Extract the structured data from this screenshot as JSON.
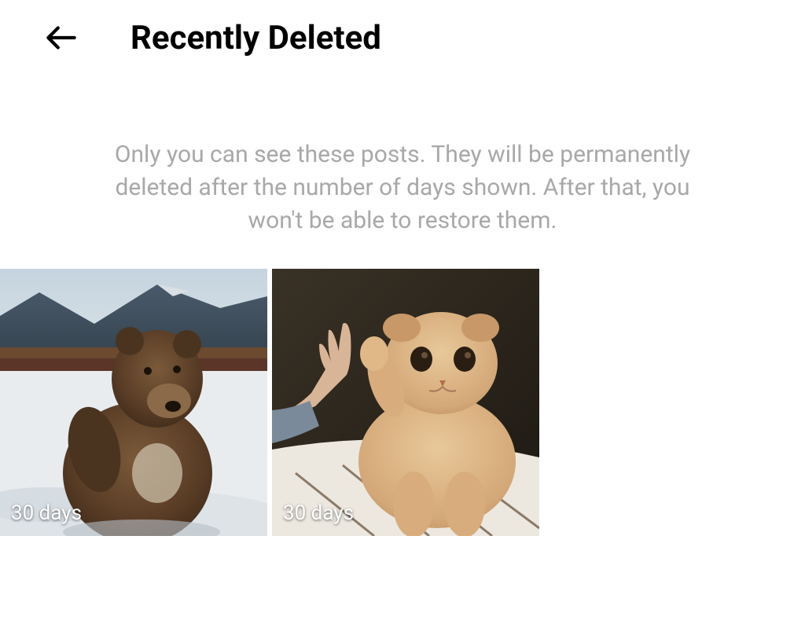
{
  "header": {
    "title": "Recently Deleted"
  },
  "description": "Only you can see these posts. They will be permanently deleted after the number of days shown. After that, you won't be able to restore them.",
  "items": [
    {
      "days_label": "30 days",
      "alt": "bear-in-snow"
    },
    {
      "days_label": "30 days",
      "alt": "cat-high-five"
    }
  ]
}
